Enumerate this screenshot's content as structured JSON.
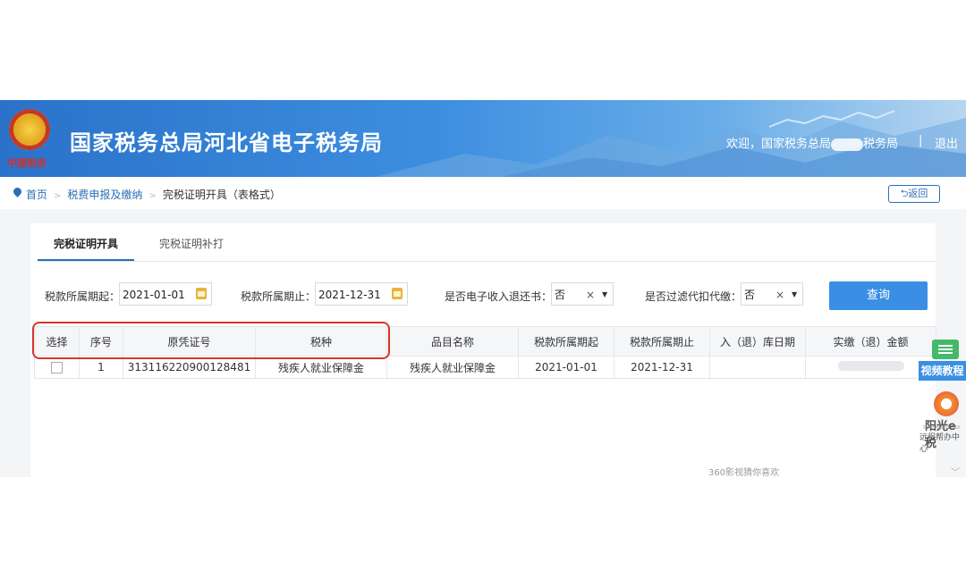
{
  "header": {
    "emblem_text": "中国税务",
    "site_title": "国家税务总局河北省电子税务局",
    "welcome": "欢迎，国家税务总局",
    "welcome_tail": "税务局",
    "separator": "|",
    "logout": "退出"
  },
  "breadcrumb": {
    "home": "首页",
    "level1": "税费申报及缴纳",
    "current": "完税证明开具（表格式）",
    "back": "返回"
  },
  "tabs": [
    {
      "label": "完税证明开具",
      "active": true
    },
    {
      "label": "完税证明补打",
      "active": false
    }
  ],
  "filters": {
    "start_label": "税款所属期起：",
    "start_value": "2021-01-01",
    "end_label": "税款所属期止：",
    "end_value": "2021-12-31",
    "receipt_label": "是否电子收入退还书：",
    "receipt_value": "否",
    "withhold_label": "是否过滤代扣代缴：",
    "withhold_value": "否",
    "clear": "×",
    "query_button": "查询"
  },
  "table": {
    "headers": [
      "选择",
      "序号",
      "原凭证号",
      "税种",
      "品目名称",
      "税款所属期起",
      "税款所属期止",
      "入（退）库日期",
      "实缴（退）金额"
    ],
    "rows": [
      {
        "seq": "1",
        "voucher": "313116220900128481",
        "tax_type": "残疾人就业保障金",
        "item": "残疾人就业保障金",
        "start": "2021-01-01",
        "end": "2021-12-31",
        "date": "",
        "amount": ""
      }
    ]
  },
  "footer_hint": "360影视猜你喜欢",
  "side": {
    "video_tutorial": "视频教程",
    "sun_brand": "阳光e税",
    "sun_en": "SUNSHINE E-TAX",
    "sun_sub": "远程帮办中心"
  },
  "colors": {
    "primary": "#3a8fe4",
    "header": "#2a72c9",
    "highlight": "#d9342b"
  }
}
